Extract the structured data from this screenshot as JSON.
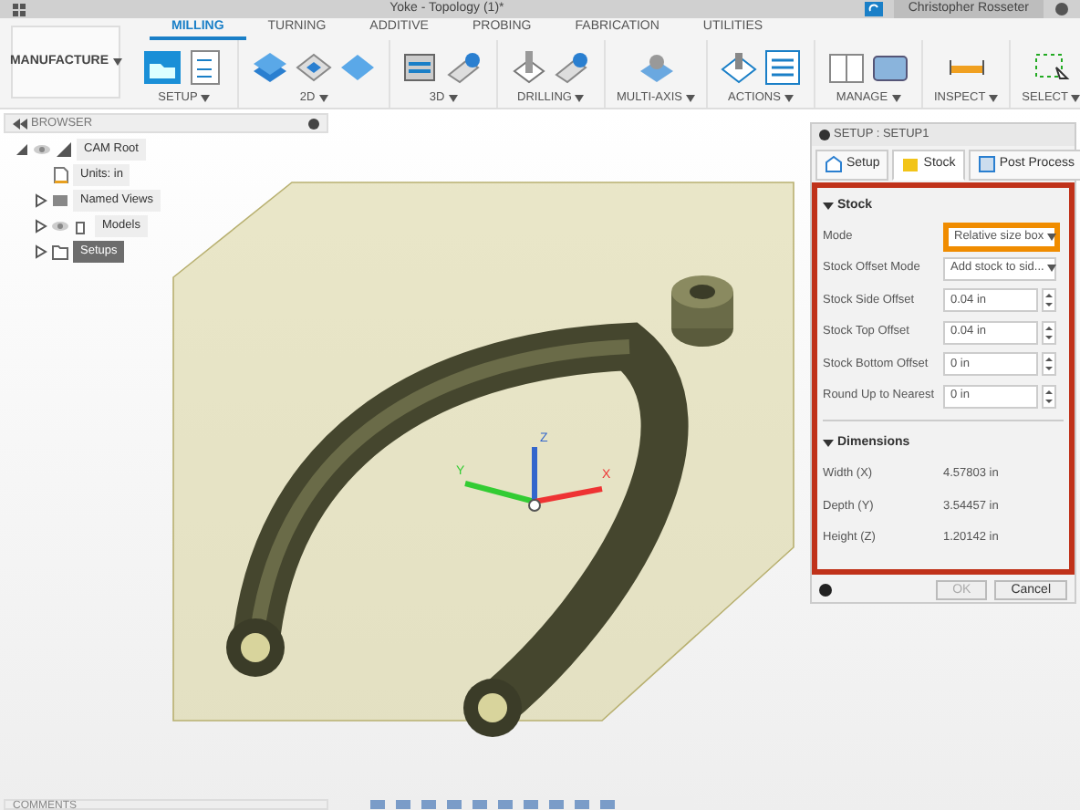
{
  "window": {
    "title": "Yoke - Topology (1)*",
    "user": "Christopher Rosseter"
  },
  "workspace_button": "MANUFACTURE",
  "tabs": [
    {
      "label": "MILLING",
      "selected": true
    },
    {
      "label": "TURNING",
      "selected": false
    },
    {
      "label": "ADDITIVE",
      "selected": false
    },
    {
      "label": "PROBING",
      "selected": false
    },
    {
      "label": "FABRICATION",
      "selected": false
    },
    {
      "label": "UTILITIES",
      "selected": false
    }
  ],
  "groups": [
    {
      "label": "SETUP",
      "kind": "setup"
    },
    {
      "label": "2D",
      "kind": "twod"
    },
    {
      "label": "3D",
      "kind": "threed"
    },
    {
      "label": "DRILLING",
      "kind": "drilling"
    },
    {
      "label": "MULTI-AXIS",
      "kind": "multiaxis"
    },
    {
      "label": "ACTIONS",
      "kind": "actions"
    },
    {
      "label": "MANAGE",
      "kind": "manage"
    },
    {
      "label": "INSPECT",
      "kind": "inspect"
    },
    {
      "label": "SELECT",
      "kind": "select"
    }
  ],
  "browser": {
    "title": "BROWSER",
    "items": [
      {
        "label": "CAM Root",
        "kind": "root",
        "visible": true,
        "expanded": true,
        "selected": false,
        "children": [
          {
            "label": "Units: in",
            "kind": "units",
            "selected": false
          },
          {
            "label": "Named Views",
            "kind": "views",
            "expanded": false,
            "selected": false
          },
          {
            "label": "Models",
            "kind": "models",
            "visible": true,
            "expanded": false,
            "selected": false
          },
          {
            "label": "Setups",
            "kind": "setups",
            "expanded": false,
            "selected": true
          }
        ]
      }
    ]
  },
  "viewport": {
    "axes": [
      {
        "label": "Y",
        "kind": "y"
      },
      {
        "label": "Z",
        "kind": "z"
      },
      {
        "label": "X",
        "kind": "x"
      }
    ]
  },
  "setup_panel": {
    "title": "SETUP : SETUP1",
    "tabs": [
      {
        "label": "Setup",
        "selected": false
      },
      {
        "label": "Stock",
        "selected": true
      },
      {
        "label": "Post Process",
        "selected": false
      }
    ],
    "sections": [
      {
        "title": "Stock",
        "expanded": true,
        "rows": [
          {
            "label": "Mode",
            "kind": "dropdown",
            "value": "Relative size box",
            "highlighted": true
          },
          {
            "label": "Stock Offset Mode",
            "kind": "dropdown",
            "value": "Add stock to sid...",
            "highlighted": false
          },
          {
            "label": "Stock Side Offset",
            "kind": "spin",
            "value": "0.04 in"
          },
          {
            "label": "Stock Top Offset",
            "kind": "spin",
            "value": "0.04 in"
          },
          {
            "label": "Stock Bottom Offset",
            "kind": "spin",
            "value": "0 in"
          },
          {
            "label": "Round Up to Nearest",
            "kind": "spin",
            "value": "0 in"
          }
        ]
      },
      {
        "title": "Dimensions",
        "expanded": true,
        "rows": [
          {
            "label": "Width (X)",
            "kind": "readout",
            "value": "4.57803 in"
          },
          {
            "label": "Depth (Y)",
            "kind": "readout",
            "value": "3.54457 in"
          },
          {
            "label": "Height (Z)",
            "kind": "readout",
            "value": "1.20142 in"
          }
        ]
      }
    ],
    "buttons": [
      {
        "label": "OK",
        "disabled": true
      },
      {
        "label": "Cancel",
        "disabled": false
      }
    ]
  },
  "comments": {
    "title": "COMMENTS"
  }
}
